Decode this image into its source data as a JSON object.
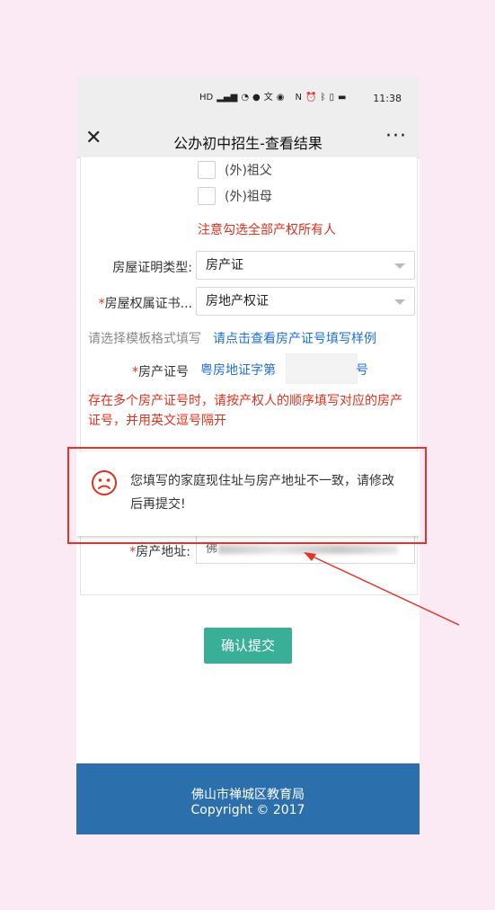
{
  "status": {
    "time": "11:38"
  },
  "titlebar": {
    "close_label": "✕",
    "title": "公办初中招生-查看结果",
    "more_label": "···"
  },
  "checkboxes": [
    {
      "label": "(外)祖父"
    },
    {
      "label": "(外)祖母"
    }
  ],
  "notice_owners": "注意勾选全部产权所有人",
  "form": {
    "proof_type": {
      "label": "房屋证明类型:",
      "value": "房产证"
    },
    "ownership_cert": {
      "label": "房屋权属证书...",
      "value": "房地产权证"
    },
    "template_hint": "请选择模板格式填写",
    "template_link": "请点击查看房产证号填写样例",
    "cert_number": {
      "label": "房产证号",
      "prefix": "粤房地证字第",
      "suffix": "号"
    },
    "multi_notice": "存在多个房产证号时，请按产权人的顺序填写对应的房产证号，并用英文逗号隔开",
    "address": {
      "label": "房产地址:",
      "value": "佛"
    }
  },
  "toast": {
    "message": "您填写的家庭现住址与房产地址不一致，请修改后再提交!"
  },
  "submit_label": "确认提交",
  "footer": {
    "org": "佛山市禅城区教育局",
    "copyright": "Copyright © 2017"
  },
  "colors": {
    "accent_green": "#3aaf98",
    "footer_blue": "#2c6fad",
    "alert_red": "#e0301e",
    "link_blue": "#1f6fd6"
  }
}
